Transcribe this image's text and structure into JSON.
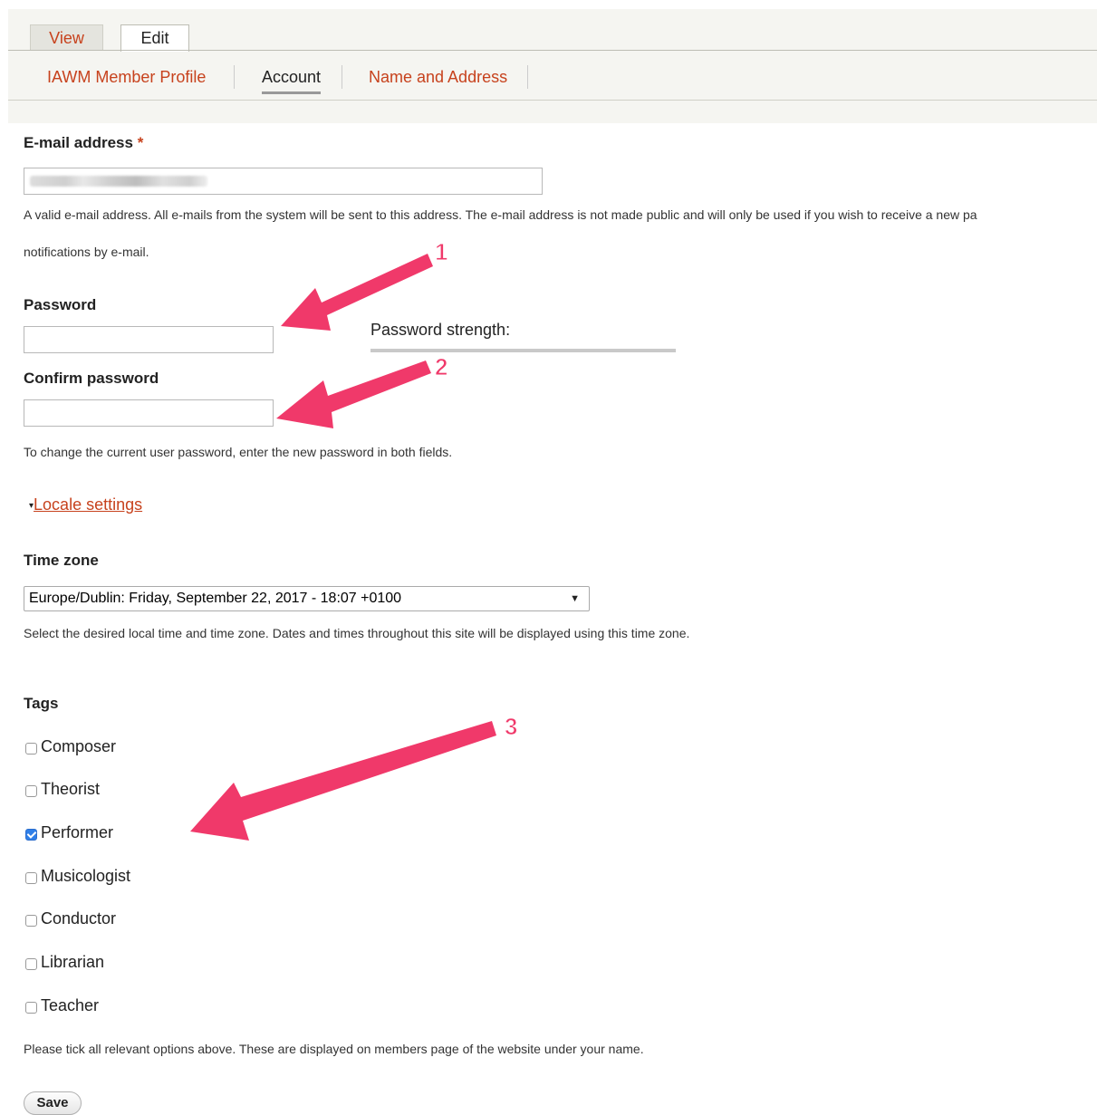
{
  "tabs": {
    "primary": [
      {
        "label": "View",
        "active": false
      },
      {
        "label": "Edit",
        "active": true
      }
    ],
    "secondary": [
      {
        "label": "IAWM Member Profile",
        "active": false
      },
      {
        "label": "Account",
        "active": true
      },
      {
        "label": "Name and Address",
        "active": false
      }
    ]
  },
  "form": {
    "email": {
      "label": "E-mail address",
      "required_mark": "*",
      "description_line1": "A valid e-mail address. All e-mails from the system will be sent to this address. The e-mail address is not made public and will only be used if you wish to receive a new pa",
      "description_line2": "notifications by e-mail."
    },
    "password": {
      "label": "Password",
      "value": "",
      "strength_label": "Password strength:",
      "strength_fraction": 0
    },
    "confirm_password": {
      "label": "Confirm password",
      "value": "",
      "description": "To change the current user password, enter the new password in both fields."
    },
    "locale": {
      "toggle_label": "Locale settings",
      "caret": "▾"
    },
    "timezone": {
      "label": "Time zone",
      "selected": "Europe/Dublin: Friday, September 22, 2017 - 18:07 +0100",
      "arrow": "▼",
      "description": "Select the desired local time and time zone. Dates and times throughout this site will be displayed using this time zone."
    },
    "tags": {
      "label": "Tags",
      "options": [
        {
          "label": "Composer",
          "checked": false
        },
        {
          "label": "Theorist",
          "checked": false
        },
        {
          "label": "Performer",
          "checked": true
        },
        {
          "label": "Musicologist",
          "checked": false
        },
        {
          "label": "Conductor",
          "checked": false
        },
        {
          "label": "Librarian",
          "checked": false
        },
        {
          "label": "Teacher",
          "checked": false
        }
      ],
      "description": "Please tick all relevant options above. These are displayed on members page of the website under your name."
    },
    "save_label": "Save"
  },
  "annotations": {
    "color": "#f0396a",
    "labels": [
      "1",
      "2",
      "3"
    ]
  }
}
